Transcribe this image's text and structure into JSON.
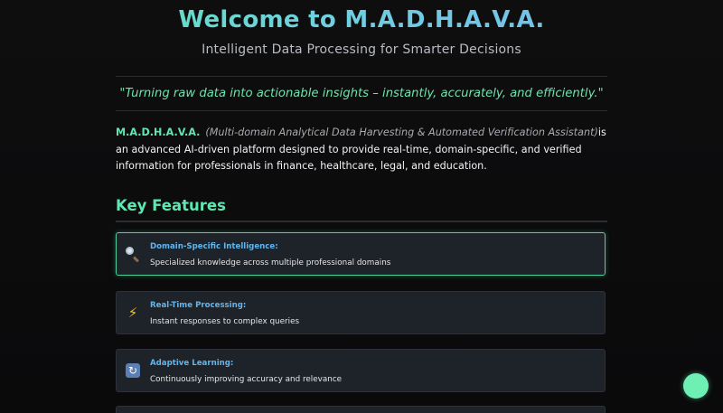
{
  "hero": {
    "title": "Welcome to M.A.D.H.A.V.A.",
    "subtitle": "Intelligent Data Processing for Smarter Decisions"
  },
  "tagline": "\"Turning raw data into actionable insights – instantly, accurately, and efficiently.\"",
  "intro": {
    "brand": "M.A.D.H.A.V.A.",
    "expansion": "(Multi-domain Analytical Data Harvesting & Automated Verification Assistant)",
    "body": "is an advanced AI-driven platform designed to provide real-time, domain-specific, and verified information for professionals in finance, healthcare, legal, and education."
  },
  "features": {
    "heading": "Key Features",
    "items": [
      {
        "icon": "magnifier-icon",
        "title": "Domain-Specific Intelligence:",
        "description": "Specialized knowledge across multiple professional domains"
      },
      {
        "icon": "lightning-icon",
        "title": "Real-Time Processing:",
        "description": "Instant responses to complex queries"
      },
      {
        "icon": "refresh-icon",
        "title": "Adaptive Learning:",
        "description": "Continuously improving accuracy and relevance"
      }
    ]
  },
  "colors": {
    "accent": "#5fe7b3",
    "feature_title": "#5fb6f0",
    "background": "#0c0c0d",
    "card": "#1e2229"
  },
  "chat_button": {
    "icon": "chat-bubble-icon"
  }
}
